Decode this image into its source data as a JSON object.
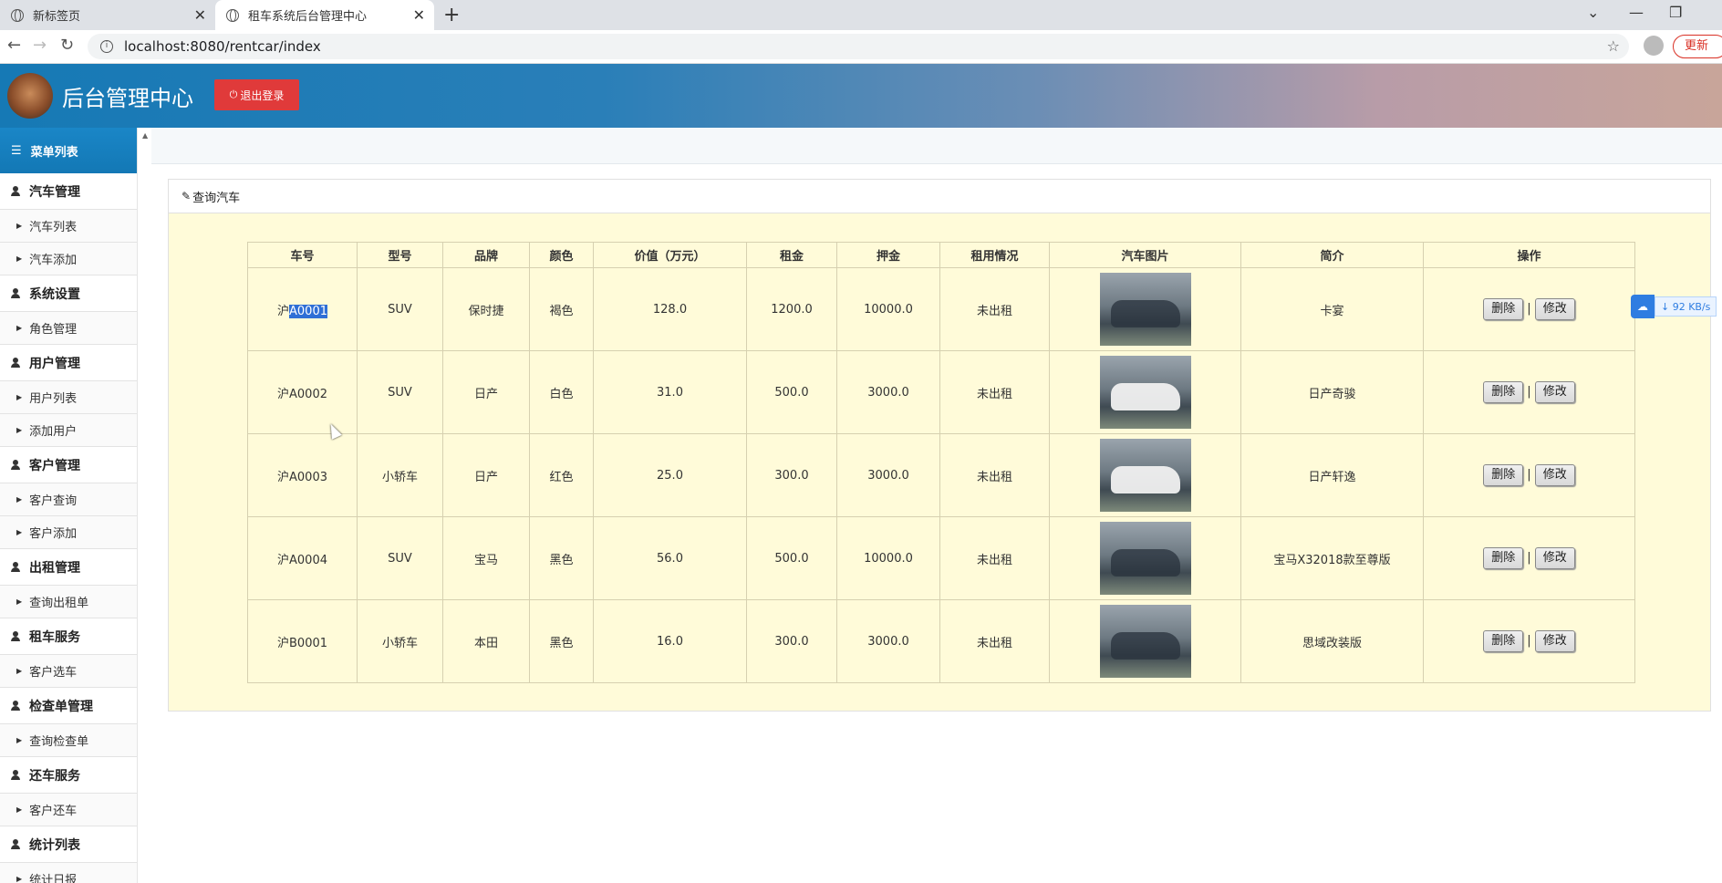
{
  "browser": {
    "tabs": [
      {
        "label": "新标签页"
      },
      {
        "label": "租车系统后台管理中心"
      }
    ],
    "url": "localhost:8080/rentcar/index",
    "update_label": "更新"
  },
  "header": {
    "title": "后台管理中心",
    "logout_label": "退出登录"
  },
  "sidebar": {
    "menu_title": "菜单列表",
    "groups": [
      {
        "label": "汽车管理",
        "items": [
          "汽车列表",
          "汽车添加"
        ]
      },
      {
        "label": "系统设置",
        "items": [
          "角色管理"
        ]
      },
      {
        "label": "用户管理",
        "items": [
          "用户列表",
          "添加用户"
        ]
      },
      {
        "label": "客户管理",
        "items": [
          "客户查询",
          "客户添加"
        ]
      },
      {
        "label": "出租管理",
        "items": [
          "查询出租单"
        ]
      },
      {
        "label": "租车服务",
        "items": [
          "客户选车"
        ]
      },
      {
        "label": "检查单管理",
        "items": [
          "查询检查单"
        ]
      },
      {
        "label": "还车服务",
        "items": [
          "客户还车"
        ]
      },
      {
        "label": "统计列表",
        "items": [
          "统计日报"
        ]
      }
    ]
  },
  "panel": {
    "title": "查询汽车"
  },
  "table": {
    "headers": [
      "车号",
      "型号",
      "品牌",
      "颜色",
      "价值（万元）",
      "租金",
      "押金",
      "租用情况",
      "汽车图片",
      "简介",
      "操作"
    ],
    "rows": [
      {
        "plate_prefix": "沪",
        "plate_rest": "A0001",
        "model": "SUV",
        "brand": "保时捷",
        "color": "褐色",
        "value": "128.0",
        "rent": "1200.0",
        "deposit": "10000.0",
        "status": "未出租",
        "desc": "卡宴"
      },
      {
        "plate_prefix": "沪",
        "plate_rest": "A0002",
        "model": "SUV",
        "brand": "日产",
        "color": "白色",
        "value": "31.0",
        "rent": "500.0",
        "deposit": "3000.0",
        "status": "未出租",
        "desc": "日产奇骏"
      },
      {
        "plate_prefix": "沪",
        "plate_rest": "A0003",
        "model": "小轿车",
        "brand": "日产",
        "color": "红色",
        "value": "25.0",
        "rent": "300.0",
        "deposit": "3000.0",
        "status": "未出租",
        "desc": "日产轩逸"
      },
      {
        "plate_prefix": "沪",
        "plate_rest": "A0004",
        "model": "SUV",
        "brand": "宝马",
        "color": "黑色",
        "value": "56.0",
        "rent": "500.0",
        "deposit": "10000.0",
        "status": "未出租",
        "desc": "宝马X32018款至尊版"
      },
      {
        "plate_prefix": "沪",
        "plate_rest": "B0001",
        "model": "小轿车",
        "brand": "本田",
        "color": "黑色",
        "value": "16.0",
        "rent": "300.0",
        "deposit": "3000.0",
        "status": "未出租",
        "desc": "思域改装版"
      }
    ],
    "delete_label": "删除",
    "edit_label": "修改",
    "separator": "|"
  },
  "download_badge": {
    "rate": "92 KB/s"
  }
}
